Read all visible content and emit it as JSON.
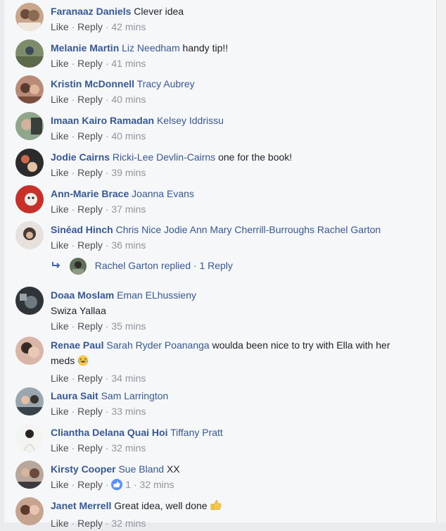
{
  "actions": {
    "like": "Like",
    "reply": "Reply",
    "separator": "·"
  },
  "comments": [
    {
      "author": "Faranaaz Daniels",
      "mentions": [],
      "text": "Clever idea",
      "time": "42 mins"
    },
    {
      "author": "Melanie Martin",
      "mentions": [
        "Liz Needham"
      ],
      "text": "handy tip!!",
      "time": "41 mins"
    },
    {
      "author": "Kristin McDonnell",
      "mentions": [
        "Tracy Aubrey"
      ],
      "text": "",
      "time": "40 mins"
    },
    {
      "author": "Imaan Kairo Ramadan",
      "mentions": [
        "Kelsey Iddrissu"
      ],
      "text": "",
      "time": "40 mins"
    },
    {
      "author": "Jodie Cairns",
      "mentions": [
        "Ricki-Lee Devlin-Cairns"
      ],
      "text": "one for the book!",
      "time": "39 mins"
    },
    {
      "author": "Ann-Marie Brace",
      "mentions": [
        "Joanna Evans"
      ],
      "text": "",
      "time": "37 mins"
    },
    {
      "author": "Sinéad Hinch",
      "mentions": [
        "Chris Nice",
        "Jodie Ann Mary Cherrill-Burroughs",
        "Rachel Garton"
      ],
      "text": "",
      "time": "36 mins",
      "replies": {
        "name": "Rachel Garton",
        "label": "replied",
        "count": "1 Reply"
      }
    },
    {
      "author": "Doaa Moslam",
      "mentions": [
        "Eman ELhussieny"
      ],
      "text": "",
      "line2": "Swiza Yallaa",
      "time": "35 mins"
    },
    {
      "author": "Renae Paul",
      "mentions": [
        "Sarah Ryder Poananga"
      ],
      "text": "woulda been nice to try with Ella with her",
      "line2": "meds",
      "emoji": "laughing-emoji",
      "time": "34 mins"
    },
    {
      "author": "Laura Sait",
      "mentions": [
        "Sam Larrington"
      ],
      "text": "",
      "time": "33 mins"
    },
    {
      "author": "Cliantha Delana Quai Hoi",
      "mentions": [
        "Tiffany Pratt"
      ],
      "text": "",
      "time": "32 mins"
    },
    {
      "author": "Kirsty Cooper",
      "mentions": [
        "Sue Bland"
      ],
      "text": "XX",
      "time": "32 mins",
      "like_count": "1"
    },
    {
      "author": "Janet Merrell",
      "mentions": [],
      "text": "Great idea, well done",
      "emoji": "thumbs-up-emoji",
      "time": "32 mins"
    }
  ],
  "colors": {
    "name": "#365899",
    "meta": "#90949c",
    "text": "#1d2129",
    "like_badge": "#5890ff"
  }
}
